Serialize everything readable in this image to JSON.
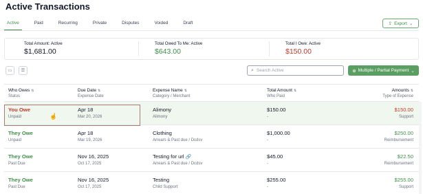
{
  "title": "Active Transactions",
  "tabs": [
    "Active",
    "Paid",
    "Recurring",
    "Private",
    "Disputes",
    "Voided",
    "Draft"
  ],
  "export_label": "Export",
  "summary": [
    {
      "label": "Total Amount: Active",
      "value": "$1,681.00",
      "color": "#111827"
    },
    {
      "label": "Total Owed To Me: Active",
      "value": "$643.00",
      "color": "#3f8f4a"
    },
    {
      "label": "Total I Owe: Active",
      "value": "$150.00",
      "color": "#c0392b"
    }
  ],
  "search_placeholder": "Search Active",
  "multi_button_label": "Multiple / Partial Payment",
  "columns": {
    "who": {
      "main": "Who Owes",
      "sub": "Status"
    },
    "due": {
      "main": "Due Date",
      "sub": "Expense Date"
    },
    "expense": {
      "main": "Expense Name",
      "sub": "Category / Merchant"
    },
    "total": {
      "main": "Total Amount",
      "sub": "Who Paid"
    },
    "amounts": {
      "main": "Amounts",
      "sub": "Type of Expense"
    }
  },
  "rows": [
    {
      "who": "You Owe",
      "status": "Unpaid",
      "due": "Apr 18",
      "expense_date": "Mar 20, 2026",
      "name": "Alimony",
      "category": "Alimony",
      "total": "$150.00",
      "who_paid": "-",
      "amount": "$150.00",
      "type": "Support",
      "who_color": "#c0392b"
    },
    {
      "who": "They Owe",
      "status": "Unpaid",
      "due": "Apr 18",
      "expense_date": "Mar 19, 2026",
      "name": "Clothing",
      "category": "Arrears & Past due / Dcdsv",
      "total": "$1,000.00",
      "who_paid": "-",
      "amount": "$250.00",
      "type": "Reimbursement",
      "who_color": "#3f8f4a"
    },
    {
      "who": "They Owe",
      "status": "Past Due",
      "due": "Nov 16, 2025",
      "expense_date": "Oct 17, 2025",
      "name": "Testing for url",
      "category": "Arrears & Past due / Dcdsv",
      "total": "$45.00",
      "who_paid": "-",
      "amount": "$22.50",
      "type": "Reimbursement",
      "who_color": "#3f8f4a"
    },
    {
      "who": "They Owe",
      "status": "Past Due",
      "due": "Nov 16, 2025",
      "expense_date": "Oct 17, 2025",
      "name": "Testing",
      "category": "Child Support",
      "total": "$255.00",
      "who_paid": "-",
      "amount": "$255.00",
      "type": "Support",
      "who_color": "#3f8f4a"
    }
  ]
}
